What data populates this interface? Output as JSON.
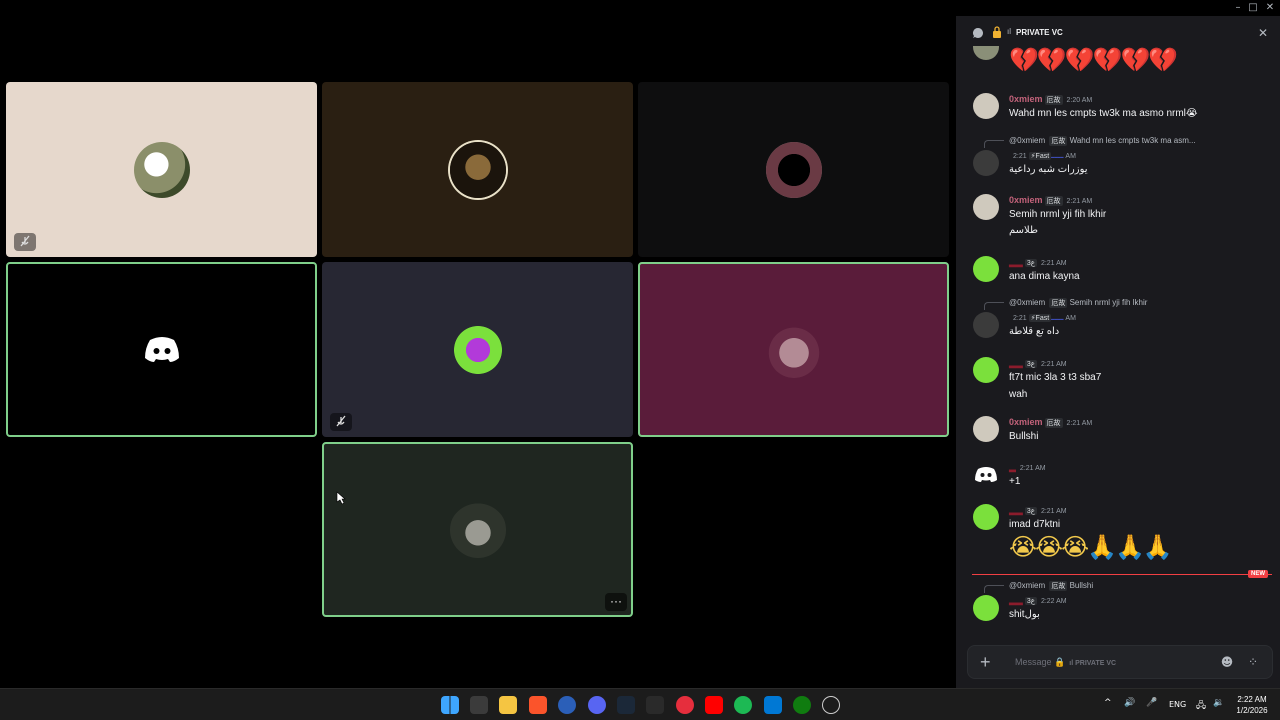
{
  "window": {
    "minimize_icon": "–",
    "maximize_icon": "□",
    "close_icon": "✕"
  },
  "channel": {
    "name": "PRIVATE VC",
    "prefix": "ıl"
  },
  "messages": [
    {
      "emoji": "💔💔💔💔💔💔"
    },
    {
      "user": "0xmiem",
      "tag": "厄故",
      "time": "2:20 AM",
      "text": "Wahd mn les cmpts tw3k ma asmo nrml😭"
    },
    {
      "reply_user": "@0xmiem",
      "reply_tag": "厄故",
      "reply_text": "Wahd mn les cmpts tw3k ma asm...",
      "tag": "⚡Fast",
      "time": "2:21 AM",
      "text": "يوزرات شبه رداعية"
    },
    {
      "user": "0xmiem",
      "tag": "厄故",
      "time": "2:21 AM",
      "text": "Semih nrml yji fih lkhir",
      "text2": "طلاسم"
    },
    {
      "tag": "ع3",
      "time": "2:21 AM",
      "text": "ana dima kayna"
    },
    {
      "reply_user": "@0xmiem",
      "reply_tag": "厄故",
      "reply_text": "Semih nrml yji fih lkhir",
      "tag": "⚡Fast",
      "time": "2:21 AM",
      "text": "داه تع قلاطة"
    },
    {
      "tag": "ع3",
      "time": "2:21 AM",
      "text": "ft7t mic 3la 3 t3 sba7",
      "text2": "wah"
    },
    {
      "user": "0xmiem",
      "tag": "厄故",
      "time": "2:21 AM",
      "text": "Bullshi"
    },
    {
      "time": "2:21 AM",
      "text": "+1"
    },
    {
      "tag": "ع3",
      "time": "2:21 AM",
      "text": "imad d7ktni",
      "emoji": "😭😭😭🙏🙏🙏"
    },
    {
      "reply_user": "@0xmiem",
      "reply_tag": "厄故",
      "reply_text": "Bullshi",
      "tag": "ع3",
      "time": "2:22 AM",
      "text": "shitبول"
    }
  ],
  "new_badge": "NEW",
  "composer": {
    "placeholder": "Message",
    "channel": "ıl PRIVATE VC",
    "plus_icon": "+"
  },
  "clock": {
    "time": "2:22 AM",
    "date": "1/2/2026"
  },
  "tray": {
    "lang": "ENG",
    "chevron": "^"
  },
  "tile_more": "···",
  "colors": {
    "speaking_outline": "#7fcf8a",
    "username": "#c2627a",
    "new_line": "#f23f43"
  }
}
